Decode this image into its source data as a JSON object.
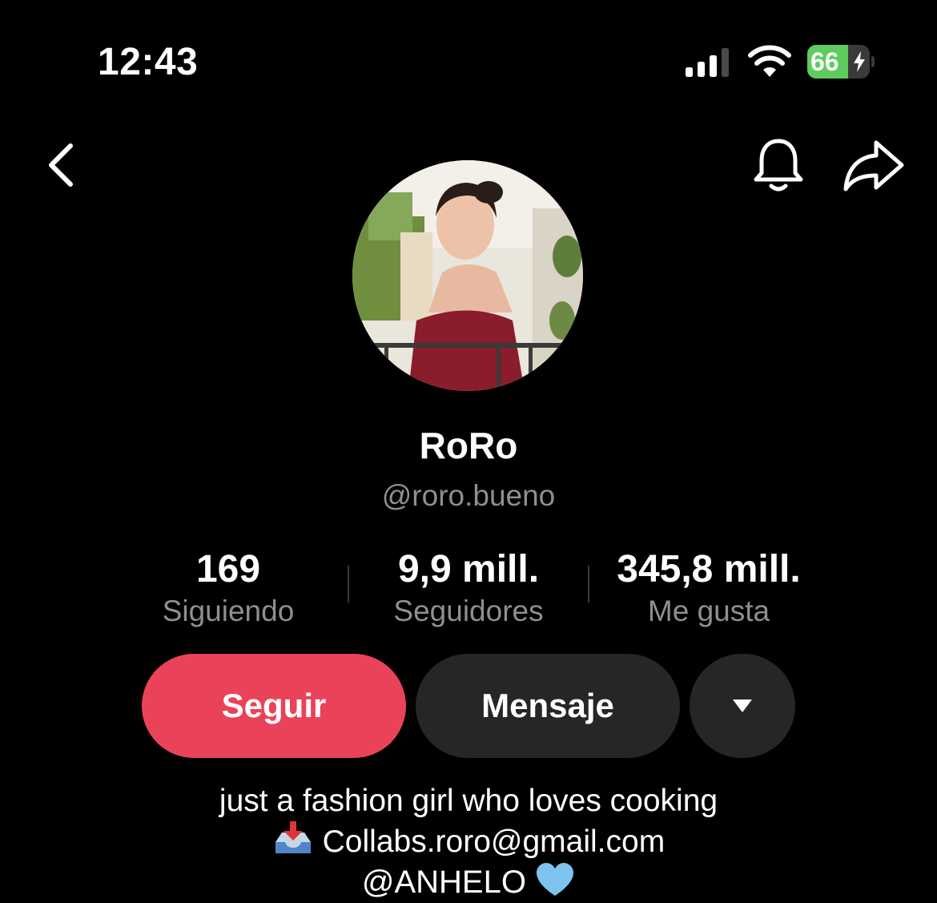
{
  "status_bar": {
    "time": "12:43",
    "battery_percent": "66",
    "battery_level": 0.66,
    "signal_icon": "cellular-signal-icon",
    "wifi_icon": "wifi-icon",
    "charging_icon": "lightning-bolt-icon"
  },
  "nav": {
    "back_icon": "chevron-left-icon",
    "notifications_icon": "bell-icon",
    "share_icon": "share-arrow-icon"
  },
  "profile": {
    "display_name": "RoRo",
    "username": "@roro.bueno"
  },
  "stats": [
    {
      "value": "169",
      "label": "Siguiendo"
    },
    {
      "value": "9,9 mill.",
      "label": "Seguidores"
    },
    {
      "value": "345,8 mill.",
      "label": "Me gusta"
    }
  ],
  "actions": {
    "follow_label": "Seguir",
    "message_label": "Mensaje",
    "more_icon": "caret-down-icon"
  },
  "bio": {
    "line1": "just a fashion girl who loves cooking",
    "line2_icon": "inbox-tray-icon",
    "line2": "Collabs.roro@gmail.com",
    "line3": "@ANHELO",
    "line3_icon": "light-blue-heart-icon"
  },
  "colors": {
    "background": "#000000",
    "follow_button": "#ea4359",
    "secondary_button": "#262626",
    "muted_text": "#8e8e93",
    "battery_green": "#5ecb5e"
  }
}
